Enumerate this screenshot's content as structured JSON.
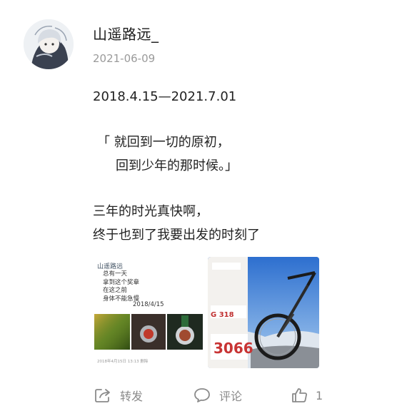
{
  "post": {
    "author": "山遥路远_",
    "date": "2021-06-09",
    "lines": [
      "2018.4.15—2021.7.01",
      "「 就回到一切的原初，",
      "回到少年的那时候。」",
      "三年的时光真快啊，",
      "终于也到了我要出发的时刻了"
    ]
  },
  "images": {
    "first": {
      "title": "山遥路远",
      "text_lines": [
        "总有一天",
        "拿到这个奖章",
        "在这之前",
        "身体不能急慢"
      ],
      "date": "2018/4/15",
      "footer": "2018年4月15日 13:13 删除"
    },
    "second": {
      "code": "G 318",
      "number": "3066"
    }
  },
  "actions": {
    "share_label": "转发",
    "comment_label": "评论",
    "like_count": "1"
  },
  "icons": {
    "share": "share-icon",
    "comment": "comment-icon",
    "like": "thumbs-up-icon"
  },
  "colors": {
    "meta_gray": "#9a9a9a",
    "action_gray": "#8a8a8a",
    "text": "#222222"
  }
}
